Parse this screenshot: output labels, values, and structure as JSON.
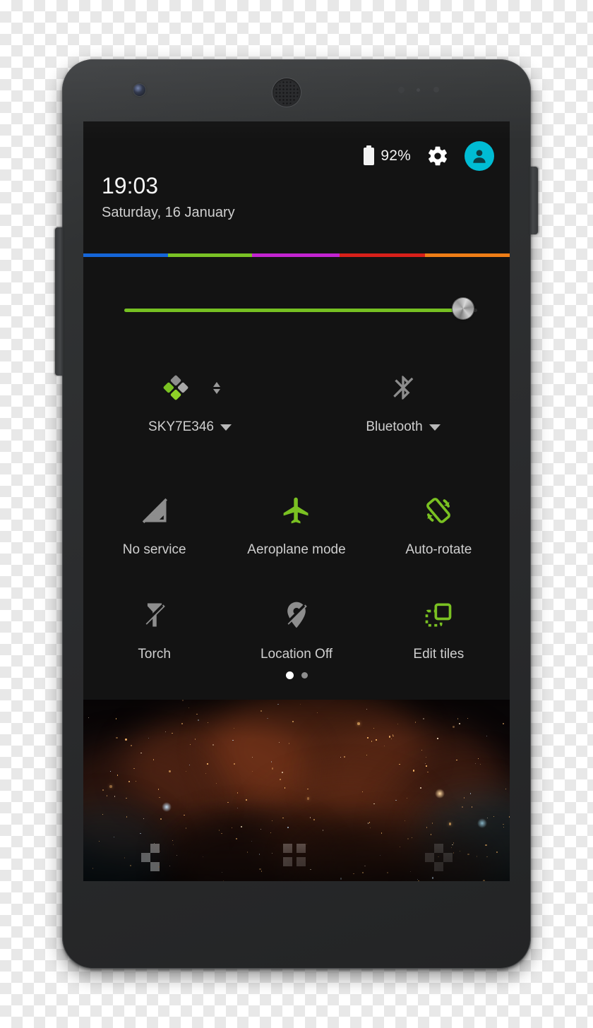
{
  "device": {
    "name": "android-phone-mockup",
    "hardware": {
      "front_camera": "front-camera",
      "earpiece": "earpiece-speaker",
      "power_key": "power-button",
      "volume_key": "volume-rocker"
    }
  },
  "status_bar": {
    "battery_icon": "battery-icon",
    "battery_percent": "92%",
    "settings_icon": "gear-icon",
    "avatar_icon": "user-avatar-icon",
    "avatar_color": "#00bcd4"
  },
  "clock": {
    "time": "19:03",
    "date": "Saturday, 16 January"
  },
  "divider": {
    "segments": [
      {
        "color": "#1565d8",
        "width": 120
      },
      {
        "color": "#7ac225",
        "width": 119
      },
      {
        "color": "#c224d0",
        "width": 124
      },
      {
        "color": "#d8201a",
        "width": 121
      },
      {
        "color": "#ee7d16",
        "width": 120
      }
    ]
  },
  "brightness": {
    "label": "brightness-slider",
    "value_percent": 96,
    "fill_color": "#76c122"
  },
  "tiles": {
    "row_top": [
      {
        "label": "SKY7E346",
        "icon": "wifi-icon",
        "state": "on",
        "accent": "#7ac122",
        "has_caret": true,
        "has_activity_arrows": true
      },
      {
        "label": "Bluetooth",
        "icon": "bluetooth-off-icon",
        "state": "off",
        "accent": "#8c8c8c",
        "has_caret": true,
        "has_activity_arrows": false
      }
    ],
    "row_mid": [
      {
        "label": "No service",
        "icon": "signal-off-icon",
        "state": "off",
        "accent": "#8c8c8c"
      },
      {
        "label": "Aeroplane mode",
        "icon": "airplane-icon",
        "state": "on",
        "accent": "#7ac122"
      },
      {
        "label": "Auto-rotate",
        "icon": "auto-rotate-icon",
        "state": "on",
        "accent": "#7ac122"
      }
    ],
    "row_bot": [
      {
        "label": "Torch",
        "icon": "flashlight-off-icon",
        "state": "off",
        "accent": "#8c8c8c"
      },
      {
        "label": "Location Off",
        "icon": "location-off-icon",
        "state": "off",
        "accent": "#8c8c8c"
      },
      {
        "label": "Edit tiles",
        "icon": "edit-tiles-icon",
        "state": "on",
        "accent": "#7ac122"
      }
    ]
  },
  "pager": {
    "total_pages": 2,
    "current_page": 1
  },
  "nav_bar": {
    "buttons": [
      {
        "name": "back-button",
        "icon": "pixel-back-icon"
      },
      {
        "name": "home-button",
        "icon": "pixel-home-icon"
      },
      {
        "name": "recents-button",
        "icon": "pixel-recents-icon"
      }
    ]
  },
  "wallpaper": {
    "description": "nebula-wallpaper",
    "base_color": "#0a0607",
    "nebula_colors": [
      "#5a2a14",
      "#7a3a1c",
      "#3a1a10",
      "#15404e"
    ]
  }
}
